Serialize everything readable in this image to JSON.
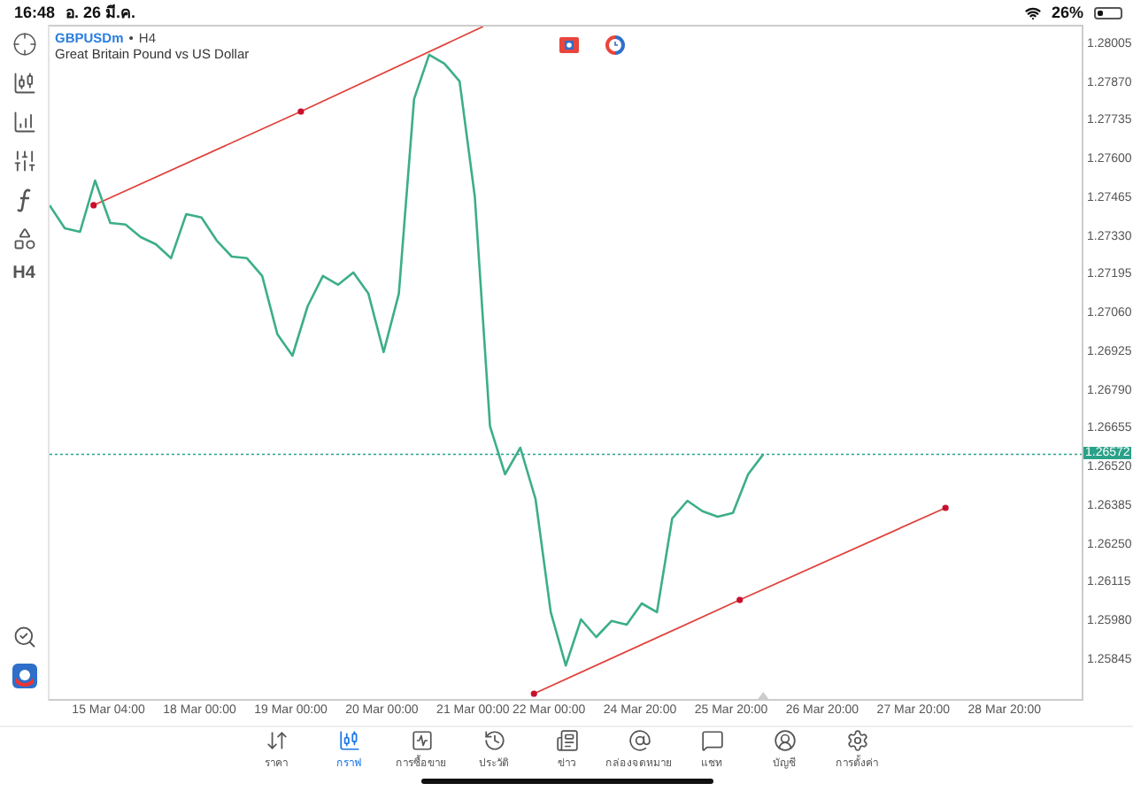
{
  "status_bar": {
    "time": "16:48",
    "date": "อ. 26 มี.ค.",
    "battery": "26%"
  },
  "chart_header": {
    "symbol": "GBPUSDm",
    "separator": "•",
    "timeframe": "H4",
    "description": "Great Britain Pound vs US Dollar"
  },
  "left_toolbar": {
    "timeframe": "H4"
  },
  "chart_data": {
    "type": "line",
    "categories": [
      null,
      null,
      null,
      null,
      "15 Mar 04:00",
      null,
      null,
      null,
      null,
      null,
      "18 Mar 00:00",
      null,
      null,
      null,
      null,
      null,
      "19 Mar 00:00",
      null,
      null,
      null,
      null,
      null,
      "20 Mar 00:00",
      null,
      null,
      null,
      null,
      null,
      "21 Mar 00:00",
      null,
      null,
      null,
      null,
      "22 Mar 00:00",
      null,
      null,
      null,
      null,
      null,
      "24 Mar 20:00",
      null,
      null,
      null,
      null,
      null,
      "25 Mar 20:00",
      null,
      null,
      null,
      null,
      null,
      "26 Mar 20:00",
      null,
      null,
      null,
      null,
      null,
      "27 Mar 20:00",
      null,
      null,
      null,
      null,
      null,
      "28 Mar 20:00",
      null,
      null,
      null,
      null
    ],
    "series": [
      {
        "color": "#3cae88",
        "values": [
          1.27446,
          1.27365,
          1.27353,
          1.27533,
          1.27384,
          1.27378,
          1.27334,
          1.27309,
          1.2726,
          1.27415,
          1.27403,
          1.27322,
          1.27266,
          1.2726,
          1.27198,
          1.26993,
          1.26918,
          1.27092,
          1.27198,
          1.27167,
          1.2721,
          1.27136,
          1.26931,
          1.27136,
          1.27819,
          1.27974,
          1.27943,
          1.27881,
          1.27477,
          1.2667,
          1.26502,
          1.26595,
          1.26415,
          1.26018,
          1.25831,
          1.25993,
          1.25931,
          1.25987,
          1.25974,
          1.26049,
          1.26018,
          1.26347,
          1.26409,
          1.26372,
          1.26353,
          1.26366,
          1.26502,
          1.26572,
          null,
          null,
          null,
          null,
          null,
          null,
          null,
          null,
          null,
          null,
          null,
          null,
          null,
          null,
          null,
          null,
          null,
          null,
          null,
          null
        ]
      }
    ],
    "ylim": [
      1.25701,
      1.28073
    ],
    "ref_lines": [
      {
        "axis": "y",
        "value": 1.26572,
        "label": "1.26572",
        "color": "#2aa189"
      }
    ],
    "yticks": [
      {
        "value": 1.28005,
        "label": "1.28005"
      },
      {
        "value": 1.2787,
        "label": "1.27870"
      },
      {
        "value": 1.27735,
        "label": "1.27735"
      },
      {
        "value": 1.276,
        "label": "1.27600"
      },
      {
        "value": 1.27465,
        "label": "1.27465"
      },
      {
        "value": 1.2733,
        "label": "1.27330"
      },
      {
        "value": 1.27195,
        "label": "1.27195"
      },
      {
        "value": 1.2706,
        "label": "1.27060"
      },
      {
        "value": 1.26925,
        "label": "1.26925"
      },
      {
        "value": 1.2679,
        "label": "1.26790"
      },
      {
        "value": 1.26655,
        "label": "1.26655"
      },
      {
        "value": 1.2652,
        "label": "1.26520"
      },
      {
        "value": 1.26385,
        "label": "1.26385"
      },
      {
        "value": 1.2625,
        "label": "1.26250"
      },
      {
        "value": 1.26115,
        "label": "1.26115"
      },
      {
        "value": 1.2598,
        "label": "1.25980"
      },
      {
        "value": 1.25845,
        "label": "1.25845"
      }
    ]
  },
  "bottom_nav": [
    {
      "label": "ราคา",
      "selected": false
    },
    {
      "label": "กราฟ",
      "selected": true
    },
    {
      "label": "การซื้อขาย",
      "selected": false
    },
    {
      "label": "ประวัติ",
      "selected": false
    },
    {
      "label": "ข่าว",
      "selected": false
    },
    {
      "label": "กล่องจดหมาย",
      "selected": false
    },
    {
      "label": "แชท",
      "selected": false
    },
    {
      "label": "บัญชี",
      "selected": false
    },
    {
      "label": "การตั้งค่า",
      "selected": false
    }
  ]
}
